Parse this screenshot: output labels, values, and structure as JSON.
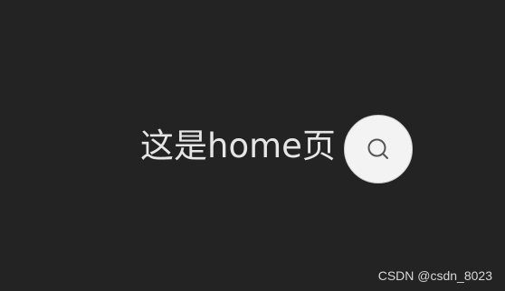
{
  "page": {
    "title": "这是home页"
  },
  "search_button": {
    "icon": "search-icon"
  },
  "watermark": {
    "text": "CSDN @csdn_8023"
  },
  "colors": {
    "background": "#232323",
    "text": "#e6e6e6",
    "button": "#f3f3f3",
    "icon": "#555555"
  }
}
